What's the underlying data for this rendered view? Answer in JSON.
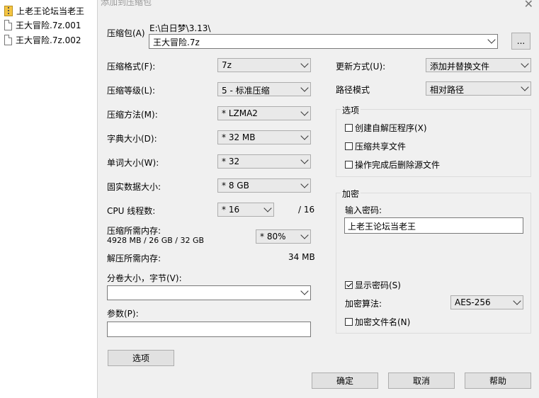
{
  "files": [
    {
      "name": "上老王论坛当老王",
      "icon": "zip-folder-icon"
    },
    {
      "name": "王大冒险.7z.001",
      "icon": "file-icon"
    },
    {
      "name": "王大冒险.7z.002",
      "icon": "file-icon"
    }
  ],
  "dialog": {
    "title": "添加到压缩包",
    "archive_label": "压缩包(A)",
    "archive_path": "E:\\白日梦\\3.13\\",
    "archive_name": "王大冒险.7z",
    "browse_label": "...",
    "format": {
      "label": "压缩格式(F):",
      "value": "7z"
    },
    "level": {
      "label": "压缩等级(L):",
      "value": "5 - 标准压缩"
    },
    "method": {
      "label": "压缩方法(M):",
      "value": "* LZMA2"
    },
    "dict": {
      "label": "字典大小(D):",
      "value": "* 32 MB"
    },
    "word": {
      "label": "单词大小(W):",
      "value": "* 32"
    },
    "solid": {
      "label": "固实数据大小:",
      "value": "* 8 GB"
    },
    "cpu": {
      "label": "CPU 线程数:",
      "value": "* 16",
      "max": "/ 16"
    },
    "mem_compress": {
      "label": "压缩所需内存:",
      "detail": "4928 MB / 26 GB / 32 GB",
      "percent": "* 80%"
    },
    "mem_decompress": {
      "label": "解压所需内存:",
      "value": "34 MB"
    },
    "split": {
      "label": "分卷大小，字节(V):",
      "value": ""
    },
    "params": {
      "label": "参数(P):",
      "value": ""
    },
    "options_button": "选项",
    "update": {
      "label": "更新方式(U):",
      "value": "添加并替换文件"
    },
    "path_mode": {
      "label": "路径模式",
      "value": "相对路径"
    },
    "options_group": {
      "title": "选项",
      "sfx": "创建自解压程序(X)",
      "shared": "压缩共享文件",
      "delete": "操作完成后删除源文件"
    },
    "encrypt_group": {
      "title": "加密",
      "password_label": "输入密码:",
      "password": "上老王论坛当老王",
      "show_password": "显示密码(S)",
      "method_label": "加密算法:",
      "method_value": "AES-256",
      "encrypt_names": "加密文件名(N)"
    },
    "ok": "确定",
    "cancel": "取消",
    "help": "帮助"
  }
}
